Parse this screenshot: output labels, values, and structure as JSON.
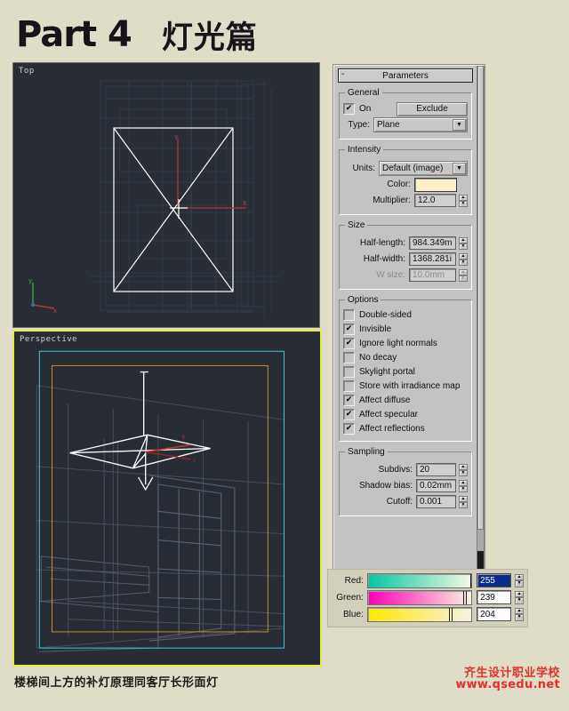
{
  "page": {
    "title_en": "Part 4",
    "title_cn": "灯光篇",
    "caption": "楼梯间上方的补灯原理同客厅长形面灯",
    "background_color": "#dfddc8"
  },
  "viewports": [
    {
      "name": "top",
      "label": "Top",
      "active": false,
      "bg_color": "#282d36"
    },
    {
      "name": "perspective",
      "label": "Perspective",
      "active": true,
      "bg_color": "#272c35",
      "active_border_color": "#e8ec4a"
    }
  ],
  "panel": {
    "rollout": {
      "collapse_glyph": "-",
      "title": "Parameters"
    },
    "general": {
      "legend": "General",
      "on_label": "On",
      "on_checked": true,
      "exclude_label": "Exclude",
      "type_label": "Type:",
      "type_value": "Plane"
    },
    "intensity": {
      "legend": "Intensity",
      "units_label": "Units:",
      "units_value": "Default (image)",
      "color_label": "Color:",
      "color_value": "#ffefcc",
      "multiplier_label": "Multiplier:",
      "multiplier_value": "12.0"
    },
    "size": {
      "legend": "Size",
      "half_length_label": "Half-length:",
      "half_length_value": "984.349m",
      "half_width_label": "Half-width:",
      "half_width_value": "1368.281i",
      "w_size_label": "W size:",
      "w_size_value": "10.0mm",
      "w_size_disabled": true
    },
    "options": {
      "legend": "Options",
      "items": [
        {
          "label": "Double-sided",
          "checked": false
        },
        {
          "label": "Invisible",
          "checked": true
        },
        {
          "label": "Ignore light normals",
          "checked": true
        },
        {
          "label": "No decay",
          "checked": false
        },
        {
          "label": "Skylight portal",
          "checked": false
        },
        {
          "label": "Store with irradiance map",
          "checked": false
        },
        {
          "label": "Affect diffuse",
          "checked": true
        },
        {
          "label": "Affect specular",
          "checked": true
        },
        {
          "label": "Affect reflections",
          "checked": true
        }
      ]
    },
    "sampling": {
      "legend": "Sampling",
      "subdivs_label": "Subdivs:",
      "subdivs_value": "20",
      "shadow_bias_label": "Shadow bias:",
      "shadow_bias_value": "0.02mm",
      "cutoff_label": "Cutoff:",
      "cutoff_value": "0.001"
    }
  },
  "rgb_sliders": {
    "rows": [
      {
        "label": "Red:",
        "value": "255",
        "selected": true,
        "gradient_from": "#00c9a0",
        "gradient_to": "#f5f7e4",
        "mark_pct": 99
      },
      {
        "label": "Green:",
        "value": "239",
        "selected": false,
        "gradient_from": "#ff00b4",
        "gradient_to": "#f6f2e0",
        "mark_pct": 93
      },
      {
        "label": "Blue:",
        "value": "204",
        "selected": false,
        "gradient_from": "#ffe800",
        "gradient_to": "#f6f2e0",
        "mark_pct": 80
      }
    ]
  },
  "watermark": {
    "line1": "齐生设计职业学校",
    "line2": "www.qsedu.net",
    "color": "#e23127"
  }
}
